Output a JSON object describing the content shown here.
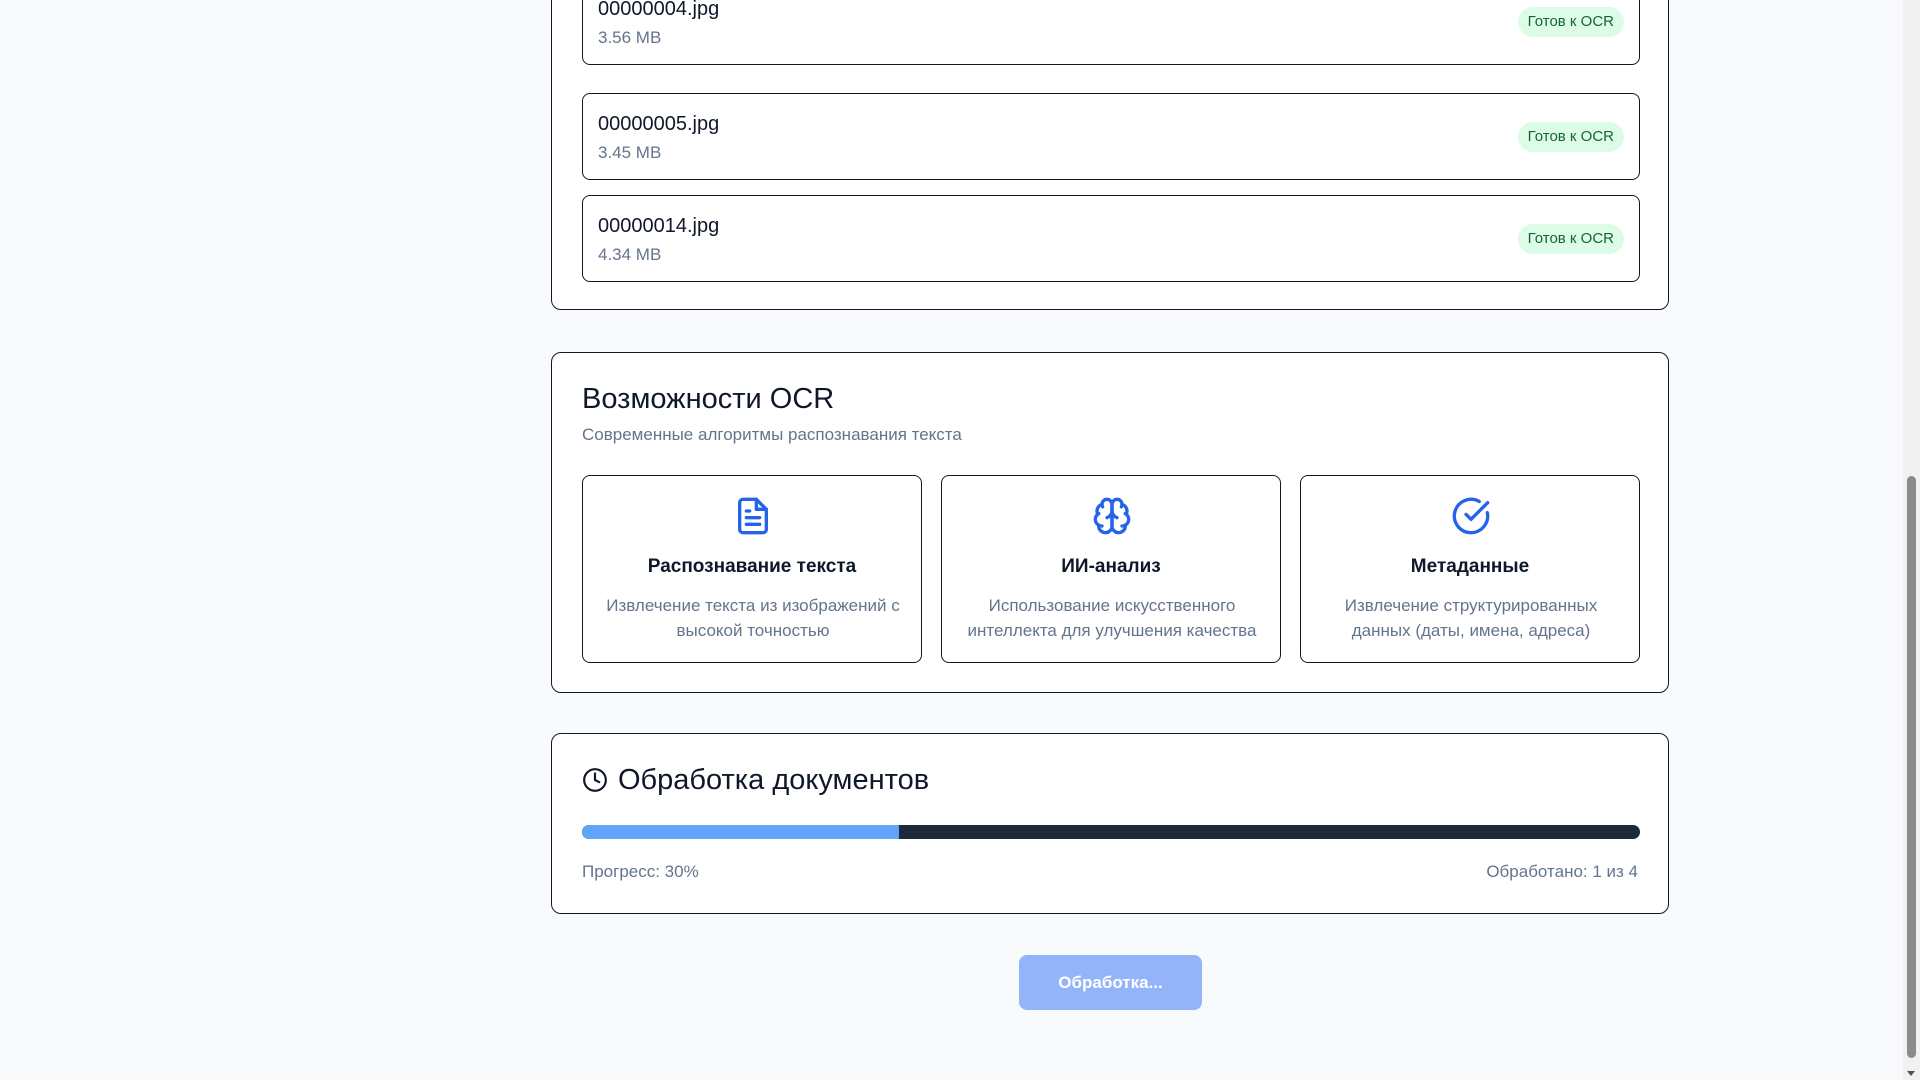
{
  "files": [
    {
      "name": "00000004.jpg",
      "size": "3.56 MB",
      "status": "Готов к OCR"
    },
    {
      "name": "00000005.jpg",
      "size": "3.45 MB",
      "status": "Готов к OCR"
    },
    {
      "name": "00000014.jpg",
      "size": "4.34 MB",
      "status": "Готов к OCR"
    }
  ],
  "features": {
    "title": "Возможности OCR",
    "subtitle": "Современные алгоритмы распознавания текста",
    "items": [
      {
        "icon": "file-text-icon",
        "title": "Распознавание текста",
        "description": "Извлечение текста из изображений с высокой точностью"
      },
      {
        "icon": "brain-icon",
        "title": "ИИ-анализ",
        "description": "Использование искусственного интеллекта для улучшения качества"
      },
      {
        "icon": "check-circle-icon",
        "title": "Метаданные",
        "description": "Извлечение структурированных данных (даты, имена, адреса)"
      }
    ]
  },
  "processing": {
    "title": "Обработка документов",
    "progress_percent": 30,
    "progress_label": "Прогресс: 30%",
    "processed_label": "Обработано: 1 из 4"
  },
  "action_button": {
    "label": "Обработка..."
  },
  "colors": {
    "accent": "#2563eb",
    "progress_fill": "#60a5fa",
    "progress_track": "#1e293b",
    "badge_bg": "#dcfce7",
    "badge_text": "#166534",
    "button_disabled": "#93b4f8"
  }
}
